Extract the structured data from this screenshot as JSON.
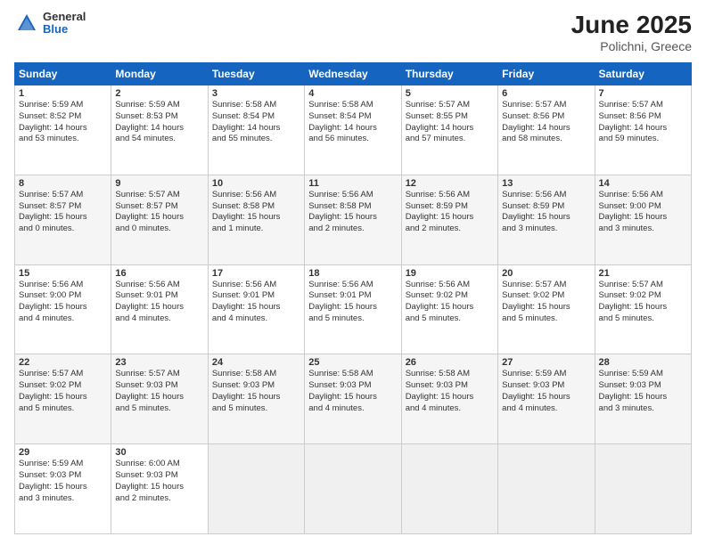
{
  "header": {
    "logo_general": "General",
    "logo_blue": "Blue",
    "month_title": "June 2025",
    "location": "Polichni, Greece"
  },
  "weekdays": [
    "Sunday",
    "Monday",
    "Tuesday",
    "Wednesday",
    "Thursday",
    "Friday",
    "Saturday"
  ],
  "weeks": [
    [
      {
        "day": "1",
        "lines": [
          "Sunrise: 5:59 AM",
          "Sunset: 8:52 PM",
          "Daylight: 14 hours",
          "and 53 minutes."
        ]
      },
      {
        "day": "2",
        "lines": [
          "Sunrise: 5:59 AM",
          "Sunset: 8:53 PM",
          "Daylight: 14 hours",
          "and 54 minutes."
        ]
      },
      {
        "day": "3",
        "lines": [
          "Sunrise: 5:58 AM",
          "Sunset: 8:54 PM",
          "Daylight: 14 hours",
          "and 55 minutes."
        ]
      },
      {
        "day": "4",
        "lines": [
          "Sunrise: 5:58 AM",
          "Sunset: 8:54 PM",
          "Daylight: 14 hours",
          "and 56 minutes."
        ]
      },
      {
        "day": "5",
        "lines": [
          "Sunrise: 5:57 AM",
          "Sunset: 8:55 PM",
          "Daylight: 14 hours",
          "and 57 minutes."
        ]
      },
      {
        "day": "6",
        "lines": [
          "Sunrise: 5:57 AM",
          "Sunset: 8:56 PM",
          "Daylight: 14 hours",
          "and 58 minutes."
        ]
      },
      {
        "day": "7",
        "lines": [
          "Sunrise: 5:57 AM",
          "Sunset: 8:56 PM",
          "Daylight: 14 hours",
          "and 59 minutes."
        ]
      }
    ],
    [
      {
        "day": "8",
        "lines": [
          "Sunrise: 5:57 AM",
          "Sunset: 8:57 PM",
          "Daylight: 15 hours",
          "and 0 minutes."
        ]
      },
      {
        "day": "9",
        "lines": [
          "Sunrise: 5:57 AM",
          "Sunset: 8:57 PM",
          "Daylight: 15 hours",
          "and 0 minutes."
        ]
      },
      {
        "day": "10",
        "lines": [
          "Sunrise: 5:56 AM",
          "Sunset: 8:58 PM",
          "Daylight: 15 hours",
          "and 1 minute."
        ]
      },
      {
        "day": "11",
        "lines": [
          "Sunrise: 5:56 AM",
          "Sunset: 8:58 PM",
          "Daylight: 15 hours",
          "and 2 minutes."
        ]
      },
      {
        "day": "12",
        "lines": [
          "Sunrise: 5:56 AM",
          "Sunset: 8:59 PM",
          "Daylight: 15 hours",
          "and 2 minutes."
        ]
      },
      {
        "day": "13",
        "lines": [
          "Sunrise: 5:56 AM",
          "Sunset: 8:59 PM",
          "Daylight: 15 hours",
          "and 3 minutes."
        ]
      },
      {
        "day": "14",
        "lines": [
          "Sunrise: 5:56 AM",
          "Sunset: 9:00 PM",
          "Daylight: 15 hours",
          "and 3 minutes."
        ]
      }
    ],
    [
      {
        "day": "15",
        "lines": [
          "Sunrise: 5:56 AM",
          "Sunset: 9:00 PM",
          "Daylight: 15 hours",
          "and 4 minutes."
        ]
      },
      {
        "day": "16",
        "lines": [
          "Sunrise: 5:56 AM",
          "Sunset: 9:01 PM",
          "Daylight: 15 hours",
          "and 4 minutes."
        ]
      },
      {
        "day": "17",
        "lines": [
          "Sunrise: 5:56 AM",
          "Sunset: 9:01 PM",
          "Daylight: 15 hours",
          "and 4 minutes."
        ]
      },
      {
        "day": "18",
        "lines": [
          "Sunrise: 5:56 AM",
          "Sunset: 9:01 PM",
          "Daylight: 15 hours",
          "and 5 minutes."
        ]
      },
      {
        "day": "19",
        "lines": [
          "Sunrise: 5:56 AM",
          "Sunset: 9:02 PM",
          "Daylight: 15 hours",
          "and 5 minutes."
        ]
      },
      {
        "day": "20",
        "lines": [
          "Sunrise: 5:57 AM",
          "Sunset: 9:02 PM",
          "Daylight: 15 hours",
          "and 5 minutes."
        ]
      },
      {
        "day": "21",
        "lines": [
          "Sunrise: 5:57 AM",
          "Sunset: 9:02 PM",
          "Daylight: 15 hours",
          "and 5 minutes."
        ]
      }
    ],
    [
      {
        "day": "22",
        "lines": [
          "Sunrise: 5:57 AM",
          "Sunset: 9:02 PM",
          "Daylight: 15 hours",
          "and 5 minutes."
        ]
      },
      {
        "day": "23",
        "lines": [
          "Sunrise: 5:57 AM",
          "Sunset: 9:03 PM",
          "Daylight: 15 hours",
          "and 5 minutes."
        ]
      },
      {
        "day": "24",
        "lines": [
          "Sunrise: 5:58 AM",
          "Sunset: 9:03 PM",
          "Daylight: 15 hours",
          "and 5 minutes."
        ]
      },
      {
        "day": "25",
        "lines": [
          "Sunrise: 5:58 AM",
          "Sunset: 9:03 PM",
          "Daylight: 15 hours",
          "and 4 minutes."
        ]
      },
      {
        "day": "26",
        "lines": [
          "Sunrise: 5:58 AM",
          "Sunset: 9:03 PM",
          "Daylight: 15 hours",
          "and 4 minutes."
        ]
      },
      {
        "day": "27",
        "lines": [
          "Sunrise: 5:59 AM",
          "Sunset: 9:03 PM",
          "Daylight: 15 hours",
          "and 4 minutes."
        ]
      },
      {
        "day": "28",
        "lines": [
          "Sunrise: 5:59 AM",
          "Sunset: 9:03 PM",
          "Daylight: 15 hours",
          "and 3 minutes."
        ]
      }
    ],
    [
      {
        "day": "29",
        "lines": [
          "Sunrise: 5:59 AM",
          "Sunset: 9:03 PM",
          "Daylight: 15 hours",
          "and 3 minutes."
        ]
      },
      {
        "day": "30",
        "lines": [
          "Sunrise: 6:00 AM",
          "Sunset: 9:03 PM",
          "Daylight: 15 hours",
          "and 2 minutes."
        ]
      },
      null,
      null,
      null,
      null,
      null
    ]
  ]
}
